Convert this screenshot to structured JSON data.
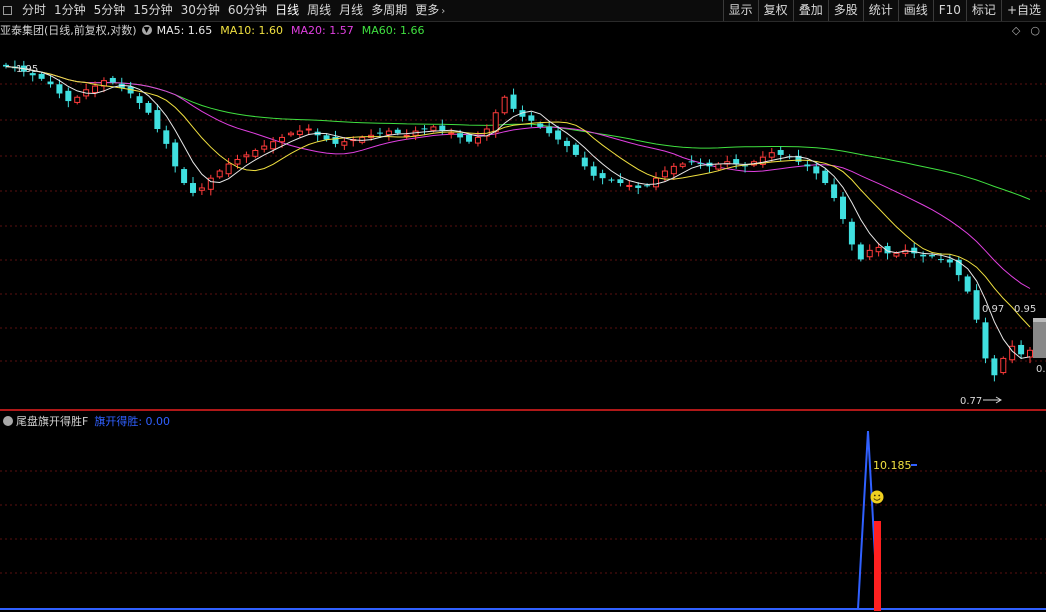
{
  "toolbar": {
    "tabs": [
      "分时",
      "1分钟",
      "5分钟",
      "15分钟",
      "30分钟",
      "60分钟",
      "日线",
      "周线",
      "月线",
      "多周期",
      "更多"
    ],
    "active_tab": "日线",
    "right_buttons": [
      "显示",
      "复权",
      "叠加",
      "多股",
      "统计",
      "画线",
      "F10",
      "标记",
      "+自选"
    ]
  },
  "main_panel": {
    "stock_title": "亚泰集团(日线,前复权,对数)",
    "ma": [
      {
        "label": "MA5: 1.65",
        "color": "#e8e8e8"
      },
      {
        "label": "MA10: 1.60",
        "color": "#f0e040"
      },
      {
        "label": "MA20: 1.57",
        "color": "#e040e0"
      },
      {
        "label": "MA60: 1.66",
        "color": "#40e040"
      }
    ],
    "high_label": "1.95",
    "price_labels": [
      "0.97",
      "0.95"
    ],
    "right_edge_label": "0.",
    "low_label": "0.77",
    "icons": [
      "diamond-icon",
      "circle-icon"
    ]
  },
  "indicator_panel": {
    "name": "尾盘旗开得胜F",
    "series_label": "旗开得胜: 0.00",
    "series_color": "#3060ff",
    "value_label": "10.185",
    "emoji": "smiley-icon"
  },
  "colors": {
    "up": "#ff3b3b",
    "down": "#40e0e0",
    "grid": "#5a1010",
    "separator": "#b01818"
  },
  "chart_data": {
    "type": "candlestick",
    "note_scale": "log",
    "series": [
      {
        "name": "MA5",
        "values_summary": "ends 1.65"
      },
      {
        "name": "MA10",
        "values_summary": "ends 1.60"
      },
      {
        "name": "MA20",
        "values_summary": "ends 1.57"
      },
      {
        "name": "MA60",
        "values_summary": "ends 1.66"
      }
    ],
    "closes": [
      1.95,
      1.94,
      1.92,
      1.9,
      1.88,
      1.85,
      1.8,
      1.76,
      1.78,
      1.82,
      1.84,
      1.87,
      1.86,
      1.83,
      1.8,
      1.75,
      1.7,
      1.62,
      1.55,
      1.45,
      1.38,
      1.34,
      1.36,
      1.4,
      1.43,
      1.46,
      1.48,
      1.5,
      1.52,
      1.54,
      1.56,
      1.58,
      1.6,
      1.61,
      1.62,
      1.59,
      1.57,
      1.55,
      1.56,
      1.57,
      1.58,
      1.59,
      1.6,
      1.61,
      1.6,
      1.59,
      1.61,
      1.62,
      1.63,
      1.61,
      1.6,
      1.58,
      1.56,
      1.58,
      1.62,
      1.7,
      1.78,
      1.72,
      1.68,
      1.66,
      1.63,
      1.6,
      1.57,
      1.54,
      1.5,
      1.45,
      1.41,
      1.4,
      1.39,
      1.38,
      1.37,
      1.36,
      1.37,
      1.4,
      1.43,
      1.45,
      1.46,
      1.47,
      1.46,
      1.45,
      1.46,
      1.47,
      1.46,
      1.45,
      1.47,
      1.49,
      1.51,
      1.5,
      1.49,
      1.47,
      1.45,
      1.42,
      1.38,
      1.32,
      1.24,
      1.15,
      1.1,
      1.13,
      1.14,
      1.12,
      1.12,
      1.13,
      1.12,
      1.11,
      1.11,
      1.1,
      1.09,
      1.05,
      1.0,
      0.92,
      0.82,
      0.78,
      0.82,
      0.85,
      0.83,
      0.84
    ],
    "indicator": {
      "name": "旗开得胜",
      "peak_value": 10.185,
      "current": 0.0
    }
  }
}
